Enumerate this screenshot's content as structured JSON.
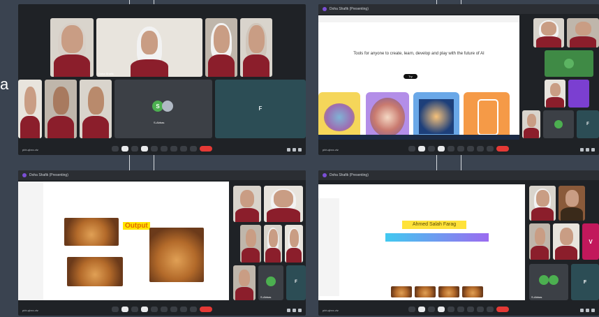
{
  "edge_letter": "a",
  "panels": {
    "p1": {
      "participants": [
        "",
        "Doha Shafik",
        "",
        "",
        "",
        "",
        "",
        "",
        ""
      ],
      "tile_label": "F",
      "avatar_label": "S-Abbas",
      "bottom_left": "pbh-qbxx-vtz"
    },
    "p2": {
      "window_title": "Doha Shafik (Presenting)",
      "headline": "Tools for anyone to create, learn, develop and play with the future of AI",
      "cta": "Try",
      "tile_letter": "F",
      "bottom_left": "pbh-qbxx-vtz"
    },
    "p3": {
      "window_title": "Doha Shafik (Presenting)",
      "output_label": "Output",
      "avatar_label": "S-Abbas",
      "tile_letter": "F",
      "bottom_left": "pbh-qbxx-vtz"
    },
    "p4": {
      "window_title": "Doha Shafik (Presenting)",
      "banner": "Ahmed Salah Farag",
      "avatar_label": "S-Abbas",
      "tile_letter_v": "V",
      "tile_letter_f": "F",
      "bottom_left": "pbh-qbxx-vtz"
    }
  },
  "colors": {
    "end_call": "#e53935",
    "accent": "#7b4fd6",
    "output_bg": "#ffe600"
  }
}
